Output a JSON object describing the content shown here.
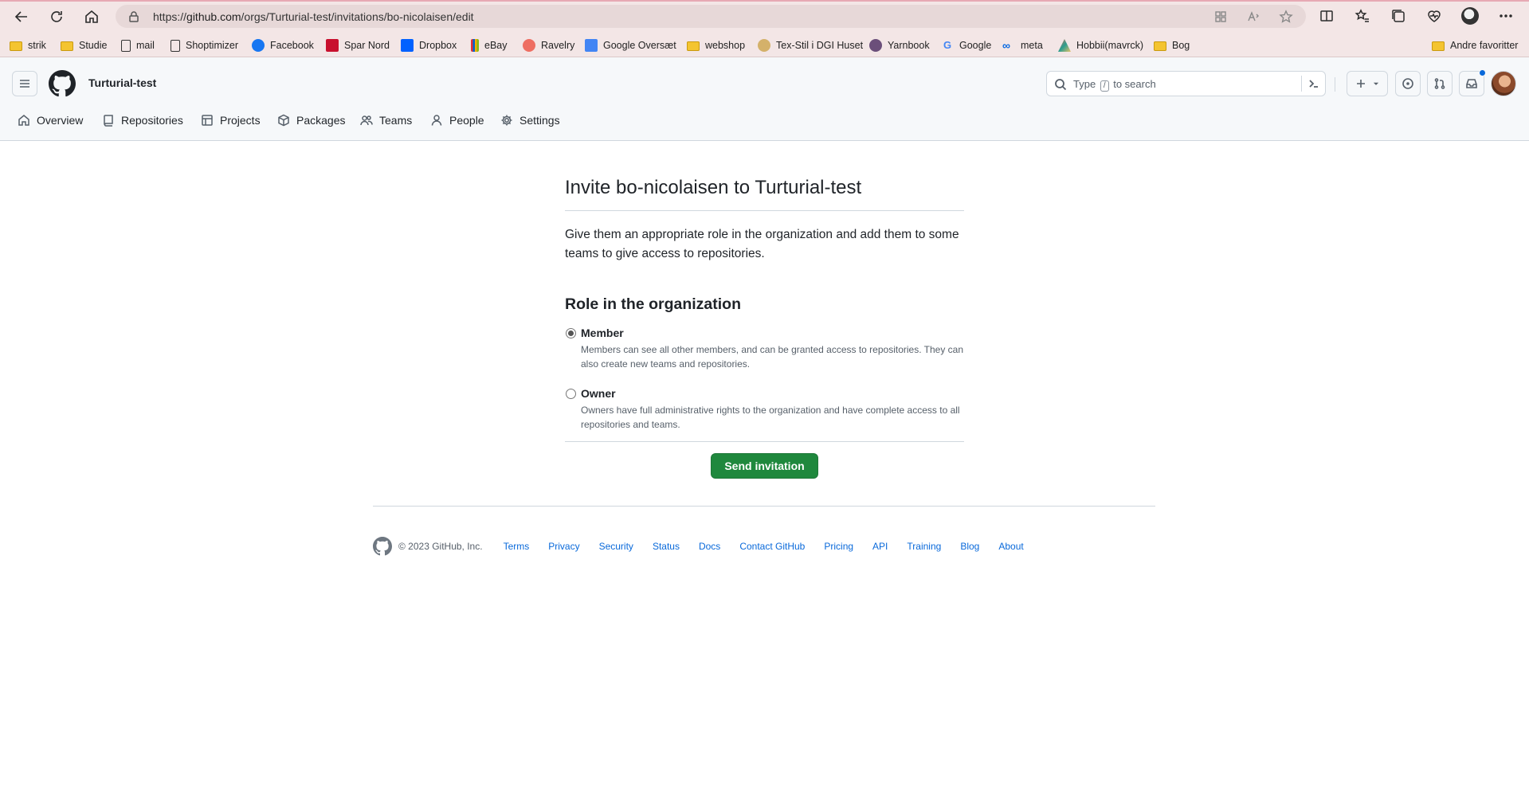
{
  "browser": {
    "url_prefix": "https://",
    "url_host": "github.com",
    "url_path": "/orgs/Turturial-test/invitations/bo-nicolaisen/edit"
  },
  "bookmarks": [
    {
      "label": "strik",
      "icon": "folder-icon"
    },
    {
      "label": "Studie",
      "icon": "folder-icon"
    },
    {
      "label": "mail",
      "icon": "page-icon"
    },
    {
      "label": "Shoptimizer",
      "icon": "page-icon"
    },
    {
      "label": "Facebook",
      "icon": "facebook-icon"
    },
    {
      "label": "Spar Nord",
      "icon": "sparnord-icon"
    },
    {
      "label": "Dropbox",
      "icon": "dropbox-icon"
    },
    {
      "label": "eBay",
      "icon": "ebay-icon"
    },
    {
      "label": "Ravelry",
      "icon": "ravelry-icon"
    },
    {
      "label": "Google Oversæt",
      "icon": "translate-icon"
    },
    {
      "label": "webshop",
      "icon": "folder-icon"
    },
    {
      "label": "Tex-Stil i DGI Huset",
      "icon": "texstil-icon"
    },
    {
      "label": "Yarnbook",
      "icon": "yarnbook-icon"
    },
    {
      "label": "Google",
      "icon": "google-icon"
    },
    {
      "label": "meta",
      "icon": "meta-icon"
    },
    {
      "label": "Hobbii(mavrck)",
      "icon": "hobbii-icon"
    },
    {
      "label": "Bog",
      "icon": "folder-icon"
    }
  ],
  "other_favorites": "Andre favoritter",
  "header": {
    "org_name": "Turturial-test",
    "search_placeholder_pre": "Type",
    "search_key": "/",
    "search_placeholder_post": "to search"
  },
  "tabs": [
    "Overview",
    "Repositories",
    "Projects",
    "Packages",
    "Teams",
    "People",
    "Settings"
  ],
  "main": {
    "title": "Invite bo-nicolaisen to Turturial-test",
    "description": "Give them an appropriate role in the organization and add them to some teams to give access to repositories.",
    "role_heading": "Role in the organization",
    "roles": [
      {
        "label": "Member",
        "note": "Members can see all other members, and can be granted access to repositories. They can also create new teams and repositories.",
        "selected": true
      },
      {
        "label": "Owner",
        "note": "Owners have full administrative rights to the organization and have complete access to all repositories and teams.",
        "selected": false
      }
    ],
    "submit_label": "Send invitation"
  },
  "footer": {
    "copyright": "© 2023 GitHub, Inc.",
    "links": [
      "Terms",
      "Privacy",
      "Security",
      "Status",
      "Docs",
      "Contact GitHub",
      "Pricing",
      "API",
      "Training",
      "Blog",
      "About"
    ]
  },
  "colors": {
    "primary_button": "#1f883d",
    "link": "#0969da",
    "browser_chrome": "#f3e6e6"
  }
}
